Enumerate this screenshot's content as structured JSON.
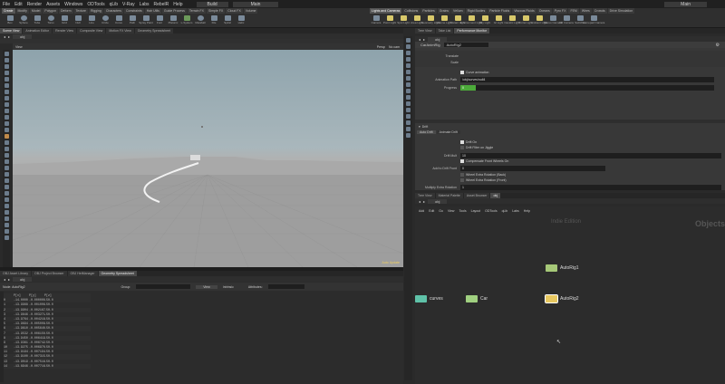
{
  "menu": [
    "File",
    "Edit",
    "Render",
    "Assets",
    "Windows",
    "ODTools",
    "qLib",
    "V-Ray",
    "Labs",
    "RebelR",
    "Help"
  ],
  "build_label": "Build",
  "desktop_label": "Main",
  "shelf_tabs": [
    "Create",
    "Modify",
    "Model",
    "Polygon",
    "Deform",
    "Texture",
    "Rigging",
    "Characters",
    "Constraints",
    "Hair Utils",
    "Guide Process",
    "Terrain FX",
    "Simple FX",
    "Cloud FX",
    "Volume"
  ],
  "tools": [
    "Box",
    "Sphere",
    "Tube",
    "Torus",
    "Grid",
    "Null",
    "Line",
    "Circle",
    "Curve",
    "Path",
    "Spray Paint",
    "Font",
    "Platonic",
    "L-System",
    "Metaball",
    "File",
    "Spiral",
    "Helix"
  ],
  "right_shelf_tabs": [
    "Lights and Cameras",
    "Collisions",
    "Particles",
    "Grains",
    "Vellum",
    "Rigid Bodies",
    "Particle Fluids",
    "Viscous Fluids",
    "Oceans",
    "Pyro FX",
    "FEM",
    "Wires",
    "Crowds",
    "Drive Simulation"
  ],
  "right_tools": [
    "Camera",
    "Point Light",
    "Spot Light",
    "Area Light",
    "Geometry Light",
    "Volume Light",
    "Distant Light",
    "Environment Light",
    "Sky Light",
    "GI Light",
    "Caustic Light",
    "Portal Light",
    "Ambient Light",
    "Stereo Camera",
    "VR Camera",
    "Switcher",
    "Gamepad Camera"
  ],
  "left_tabs": [
    "Scene View",
    "Animation Editor",
    "Render View",
    "Composite View",
    "Motion FX View",
    "Geometry Spreadsheet"
  ],
  "viewport": {
    "path": "obj",
    "view_label": "View",
    "persp": "Persp",
    "cam": "No cam",
    "status": "Auto Update"
  },
  "sheet": {
    "tabs": [
      "OBJ Asset Library",
      "OBJ Project Browser",
      "OBJ HetManager",
      "Geometry Spreadsheet"
    ],
    "path": "obj",
    "node": "Node: AutoRig2",
    "group_label": "Group:",
    "view_label": "View",
    "intrinsic_label": "Intrinsic",
    "attributes_label": "Attributes:",
    "headers": [
      "",
      "P[x]",
      "P[y]",
      "P[z]"
    ],
    "rows": [
      [
        "0",
        "-14.0000",
        "-0.000000",
        "-50.0"
      ],
      [
        "1",
        "-13.9968",
        "-0.001006",
        "-50.0"
      ],
      [
        "2",
        "-13.9904",
        "-0.002167",
        "-50.0"
      ],
      [
        "3",
        "-13.9846",
        "-0.003271",
        "-50.0"
      ],
      [
        "4",
        "-13.9764",
        "-0.004218",
        "-50.0"
      ],
      [
        "5",
        "-13.9694",
        "-0.005008",
        "-50.0"
      ],
      [
        "6",
        "-13.9610",
        "-0.005640",
        "-50.0"
      ],
      [
        "7",
        "-13.9532",
        "-0.006150",
        "-50.0"
      ],
      [
        "8",
        "-13.9450",
        "-0.006419",
        "-50.0"
      ],
      [
        "9",
        "-13.9361",
        "-0.006742",
        "-50.0"
      ],
      [
        "10",
        "-13.9275",
        "-0.006970",
        "-50.0"
      ],
      [
        "11",
        "-13.9194",
        "-0.007194",
        "-50.0"
      ],
      [
        "12",
        "-13.9100",
        "-0.007315",
        "-50.0"
      ],
      [
        "13",
        "-13.9019",
        "-0.007516",
        "-50.0"
      ],
      [
        "14",
        "-13.8946",
        "-0.007716",
        "-50.0"
      ]
    ]
  },
  "params": {
    "tabs": [
      "Tree View",
      "Take List",
      "Performance Monitor"
    ],
    "path": "obj",
    "node_type": "CarAnimRig",
    "node_name": "AutoRig2",
    "translate_label": "Translate",
    "rotate_label": "Rotate",
    "scale_label": "Scale",
    "curve_animation_label": "Curve animation",
    "animation_path_label": "Animation Path",
    "animation_path_value": "/obj/curves/null4",
    "progress_label": "Progress",
    "progress_value": "0",
    "progress_fraction": 0.06,
    "drift_label": "Drift",
    "drift_tabs": [
      "Auto Drift",
      "Animate Drift"
    ],
    "drift_on_label": "Drift On",
    "drift_filter_label": "Drift Filter on Jiggle",
    "drift_multi_label": "Drift Mult",
    "drift_multi_value": "10",
    "compensate_label": "Compensate Front Wheels On",
    "add_drift_label": "Add to Drift Front",
    "add_drift_value": "0",
    "wheel_extra_back": "Wheel Extra Rotation (Back)",
    "wheel_extra_front": "Wheel Extra Rotation (Front)",
    "multiply_label": "Multiply Extra Rotation",
    "multiply_value": "1"
  },
  "network": {
    "tabs": [
      "Tree View",
      "Material Palette",
      "Asset Browser",
      "obj"
    ],
    "path": "obj",
    "menu": [
      "Add",
      "Edit",
      "Go",
      "View",
      "Tools",
      "Layout",
      "ODTools",
      "qLib",
      "Labs",
      "Help"
    ],
    "context_label": "Objects",
    "mode_label": "Indie Edition",
    "nodes": [
      {
        "name": "AutoRig1",
        "color": "#a6c878"
      },
      {
        "name": "curves",
        "color": "#5fc2a8"
      },
      {
        "name": "Car",
        "color": "#a0d080"
      },
      {
        "name": "AutoRig2",
        "color": "#e8c860"
      }
    ]
  }
}
